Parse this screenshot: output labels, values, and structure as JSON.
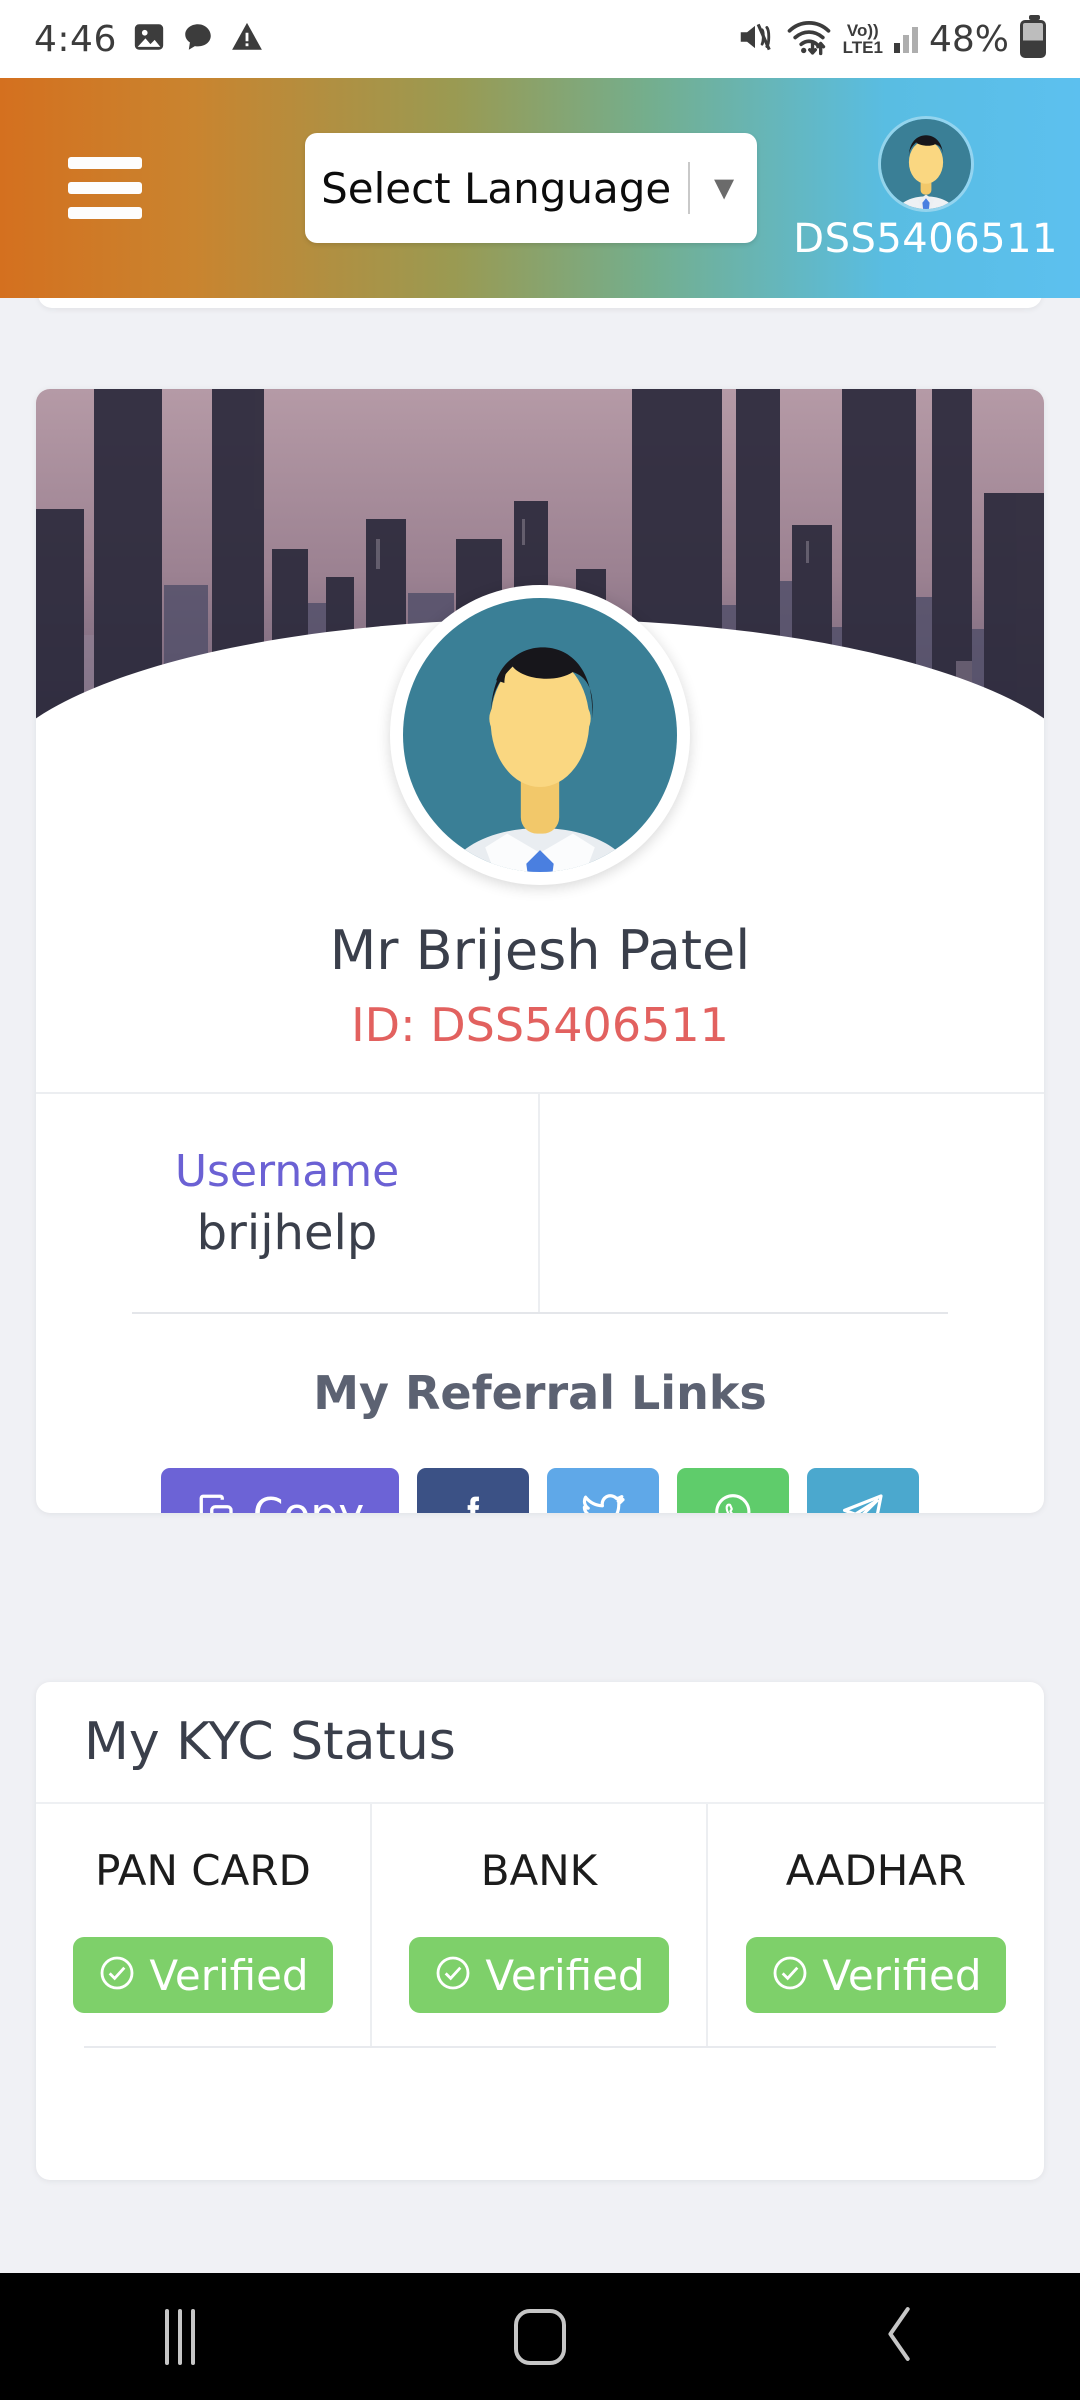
{
  "statusbar": {
    "time": "4:46",
    "icons_left": [
      "image-icon",
      "chat-bubble-icon",
      "warning-triangle-icon"
    ],
    "mute_icon": "volume-mute-icon",
    "wifi_icon": "wifi-icon",
    "network_label_top": "Vo))",
    "network_label_bottom": "LTE1",
    "signal_icon": "signal-bars-icon",
    "battery_percent": "48%",
    "battery_icon": "battery-icon"
  },
  "header": {
    "menu_icon": "hamburger-menu-icon",
    "language_label": "Select Language",
    "language_caret": "▼",
    "avatar_icon": "user-avatar-icon",
    "user_id": "DSS5406511",
    "gradient_start": "#d4701f",
    "gradient_end": "#5cc0ef"
  },
  "profile": {
    "banner_icon": "cityscape-banner-image",
    "avatar_icon": "user-avatar-large-icon",
    "name": "Mr Brijesh Patel",
    "id_text": "ID: DSS5406511",
    "id_color": "#e2615f",
    "username_label": "Username",
    "username_label_color": "#6b61d4",
    "username_value": "brijhelp",
    "referral_title": "My Referral Links",
    "referral_buttons": [
      {
        "label": "Copy",
        "icon": "copy-icon",
        "color": "#6c63d6"
      },
      {
        "label": "",
        "icon": "facebook-icon",
        "color": "#3b5185"
      },
      {
        "label": "",
        "icon": "twitter-icon",
        "color": "#5fa8e8"
      },
      {
        "label": "",
        "icon": "whatsapp-icon",
        "color": "#5fcc6b"
      },
      {
        "label": "",
        "icon": "telegram-icon",
        "color": "#4ba8ce"
      }
    ]
  },
  "kyc": {
    "title": "My KYC Status",
    "status_color": "#7ed06a",
    "items": [
      {
        "label": "PAN CARD",
        "status": "Verified",
        "icon": "check-circle-icon"
      },
      {
        "label": "BANK",
        "status": "Verified",
        "icon": "check-circle-icon"
      },
      {
        "label": "AADHAR",
        "status": "Verified",
        "icon": "check-circle-icon"
      }
    ]
  },
  "navbar": {
    "recents_icon": "recents-icon",
    "home_icon": "home-icon",
    "back_icon": "back-chevron-icon"
  }
}
